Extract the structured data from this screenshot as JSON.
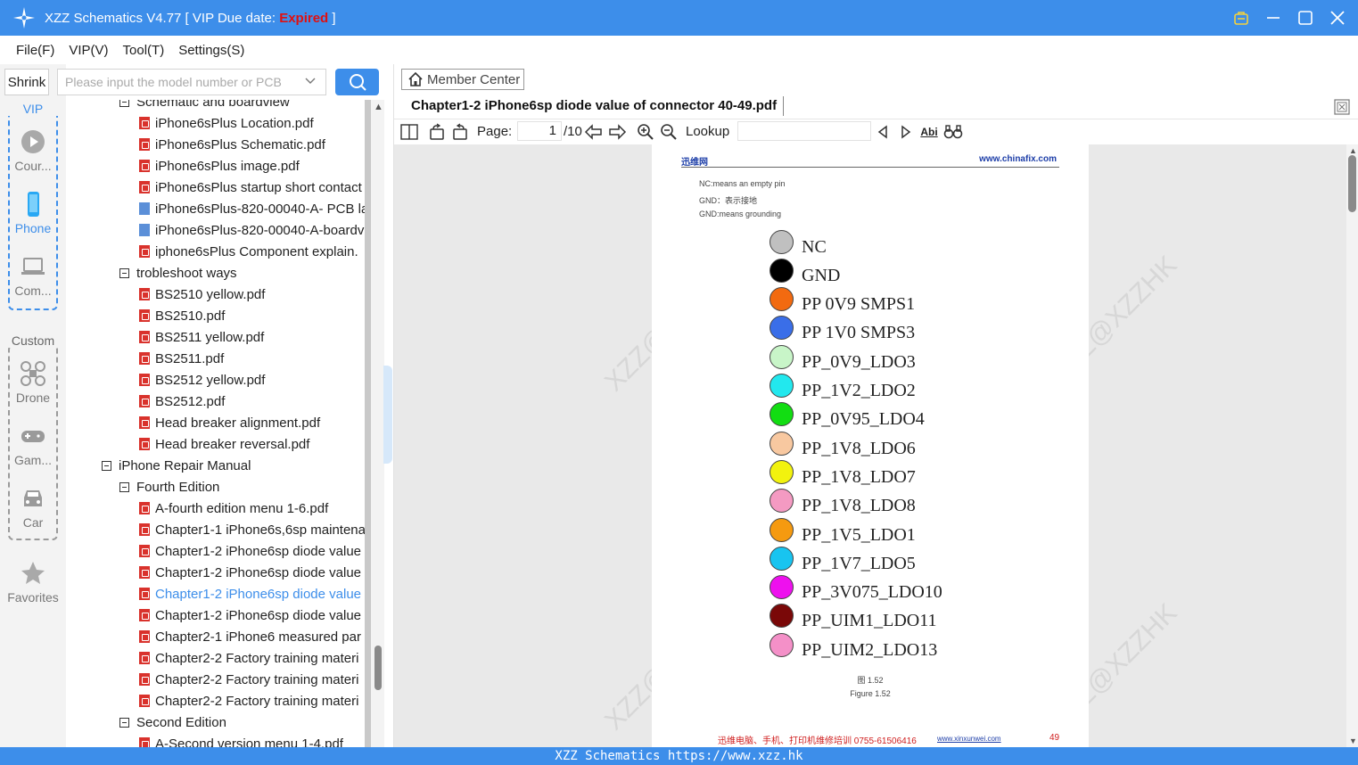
{
  "titlebar": {
    "app": "XZZ Schematics V4.77 [ VIP Due date: ",
    "status": "Expired",
    "suffix": " ]"
  },
  "menu": [
    "File(F)",
    "VIP(V)",
    "Tool(T)",
    "Settings(S)"
  ],
  "left": {
    "shrink": "Shrink",
    "vip_label": "VIP",
    "custom_label": "Custom",
    "nav": [
      {
        "label": "Cour...",
        "icon": "play-icon"
      },
      {
        "label": "Phone",
        "icon": "phone-icon"
      },
      {
        "label": "Com...",
        "icon": "laptop-icon"
      },
      {
        "label": "Drone",
        "icon": "drone-icon"
      },
      {
        "label": "Gam...",
        "icon": "gamepad-icon"
      },
      {
        "label": "Car",
        "icon": "car-icon"
      },
      {
        "label": "Favorites",
        "icon": "star-icon"
      }
    ]
  },
  "search": {
    "placeholder": "Please input the model number or PCB"
  },
  "tree": [
    {
      "label": "Schematic and boardview",
      "type": "folder"
    },
    {
      "label": "iPhone6sPlus Location.pdf",
      "type": "pdf"
    },
    {
      "label": "iPhone6sPlus Schematic.pdf",
      "type": "pdf"
    },
    {
      "label": "iPhone6sPlus image.pdf",
      "type": "pdf"
    },
    {
      "label": "iPhone6sPlus startup short contact",
      "type": "pdf"
    },
    {
      "label": "iPhone6sPlus-820-00040-A- PCB la",
      "type": "pcb"
    },
    {
      "label": "iPhone6sPlus-820-00040-A-boardv",
      "type": "pcb"
    },
    {
      "label": "iphone6sPlus Component explain.",
      "type": "pdf"
    },
    {
      "label": "trobleshoot ways",
      "type": "folder"
    },
    {
      "label": "BS2510 yellow.pdf",
      "type": "pdf"
    },
    {
      "label": "BS2510.pdf",
      "type": "pdf"
    },
    {
      "label": "BS2511 yellow.pdf",
      "type": "pdf"
    },
    {
      "label": "BS2511.pdf",
      "type": "pdf"
    },
    {
      "label": "BS2512 yellow.pdf",
      "type": "pdf"
    },
    {
      "label": "BS2512.pdf",
      "type": "pdf"
    },
    {
      "label": "Head breaker alignment.pdf",
      "type": "pdf"
    },
    {
      "label": "Head breaker reversal.pdf",
      "type": "pdf"
    },
    {
      "label": "iPhone Repair Manual",
      "type": "folder0"
    },
    {
      "label": "Fourth Edition",
      "type": "folder"
    },
    {
      "label": "A-fourth edition menu 1-6.pdf",
      "type": "pdf"
    },
    {
      "label": "Chapter1-1 iPhone6s,6sp maintena",
      "type": "pdf"
    },
    {
      "label": "Chapter1-2 iPhone6sp diode value",
      "type": "pdf"
    },
    {
      "label": "Chapter1-2 iPhone6sp diode value",
      "type": "pdf"
    },
    {
      "label": "Chapter1-2 iPhone6sp diode value",
      "type": "pdf",
      "selected": true
    },
    {
      "label": "Chapter1-2 iPhone6sp diode value",
      "type": "pdf"
    },
    {
      "label": "Chapter2-1 iPhone6 measured par",
      "type": "pdf"
    },
    {
      "label": "Chapter2-2 Factory training materi",
      "type": "pdf"
    },
    {
      "label": "Chapter2-2 Factory training materi",
      "type": "pdf"
    },
    {
      "label": "Chapter2-2 Factory training materi",
      "type": "pdf"
    },
    {
      "label": "Second Edition",
      "type": "folder"
    },
    {
      "label": "A-Second version menu 1-4.pdf",
      "type": "pdf"
    }
  ],
  "right": {
    "member_center": "Member Center",
    "doc_title": "Chapter1-2 iPhone6sp diode value of connector 40-49.pdf",
    "page_label": "Page:",
    "page_current": "1",
    "page_total": "/10",
    "lookup_label": "Lookup"
  },
  "document": {
    "header_left": "迅维网",
    "header_right": "www.chinafix.com",
    "notes": [
      "NC:means an empty pin",
      "GND：表示接地",
      "GND:means grounding"
    ],
    "legend": [
      {
        "label": "NC",
        "color": "#c0c0c0"
      },
      {
        "label": "GND",
        "color": "#000000"
      },
      {
        "label": "PP 0V9 SMPS1",
        "color": "#f26a10"
      },
      {
        "label": "PP 1V0 SMPS3",
        "color": "#3a6ee8"
      },
      {
        "label": "PP_0V9_LDO3",
        "color": "#c8f5c8"
      },
      {
        "label": "PP_1V2_LDO2",
        "color": "#22e8ee"
      },
      {
        "label": "PP_0V95_LDO4",
        "color": "#12dd12"
      },
      {
        "label": "PP_1V8_LDO6",
        "color": "#f8c8a0"
      },
      {
        "label": "PP_1V8_LDO7",
        "color": "#f2f20e"
      },
      {
        "label": "PP_1V8_LDO8",
        "color": "#f49ac2"
      },
      {
        "label": "PP_1V5_LDO1",
        "color": "#f59a10"
      },
      {
        "label": "PP_1V7_LDO5",
        "color": "#18c4f0"
      },
      {
        "label": "PP_3V075_LDO10",
        "color": "#ee10ee"
      },
      {
        "label": "PP_UIM1_LDO11",
        "color": "#7a0808"
      },
      {
        "label": "PP_UIM2_LDO13",
        "color": "#f490c8"
      }
    ],
    "figure_cn": "图 1.52",
    "figure_en": "Figure 1.52",
    "footer": "迅维电脑、手机、打印机维修培训   0755-61506416",
    "footer_link": "www.xinxunwei.com",
    "page_number": "49",
    "watermark": "XZZ@XZZHK"
  },
  "status": "XZZ Schematics https://www.xzz.hk"
}
